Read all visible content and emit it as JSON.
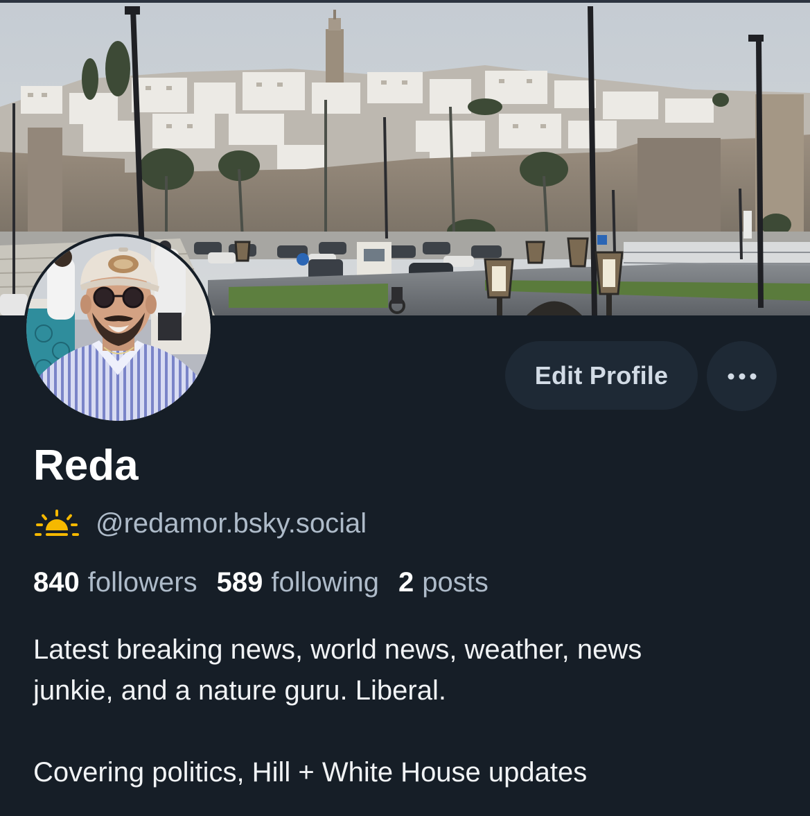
{
  "profile": {
    "display_name": "Reda",
    "handle": "@redamor.bsky.social",
    "handle_icon": "sunrise-icon",
    "stats": {
      "followers_count": "840",
      "followers_label": "followers",
      "following_count": "589",
      "following_label": "following",
      "posts_count": "2",
      "posts_label": "posts"
    },
    "bio": {
      "line1": "Latest breaking news, world news, weather, news",
      "line2": "junkie, and a nature guru. Liberal.",
      "line3": "Covering politics, Hill + White House updates"
    }
  },
  "actions": {
    "edit_profile_label": "Edit Profile",
    "more_icon": "ellipsis-icon"
  },
  "colors": {
    "background": "#161e27",
    "button_bg": "#1e2935",
    "handle_icon": "#f5b800",
    "muted_text": "#aebbc9"
  }
}
